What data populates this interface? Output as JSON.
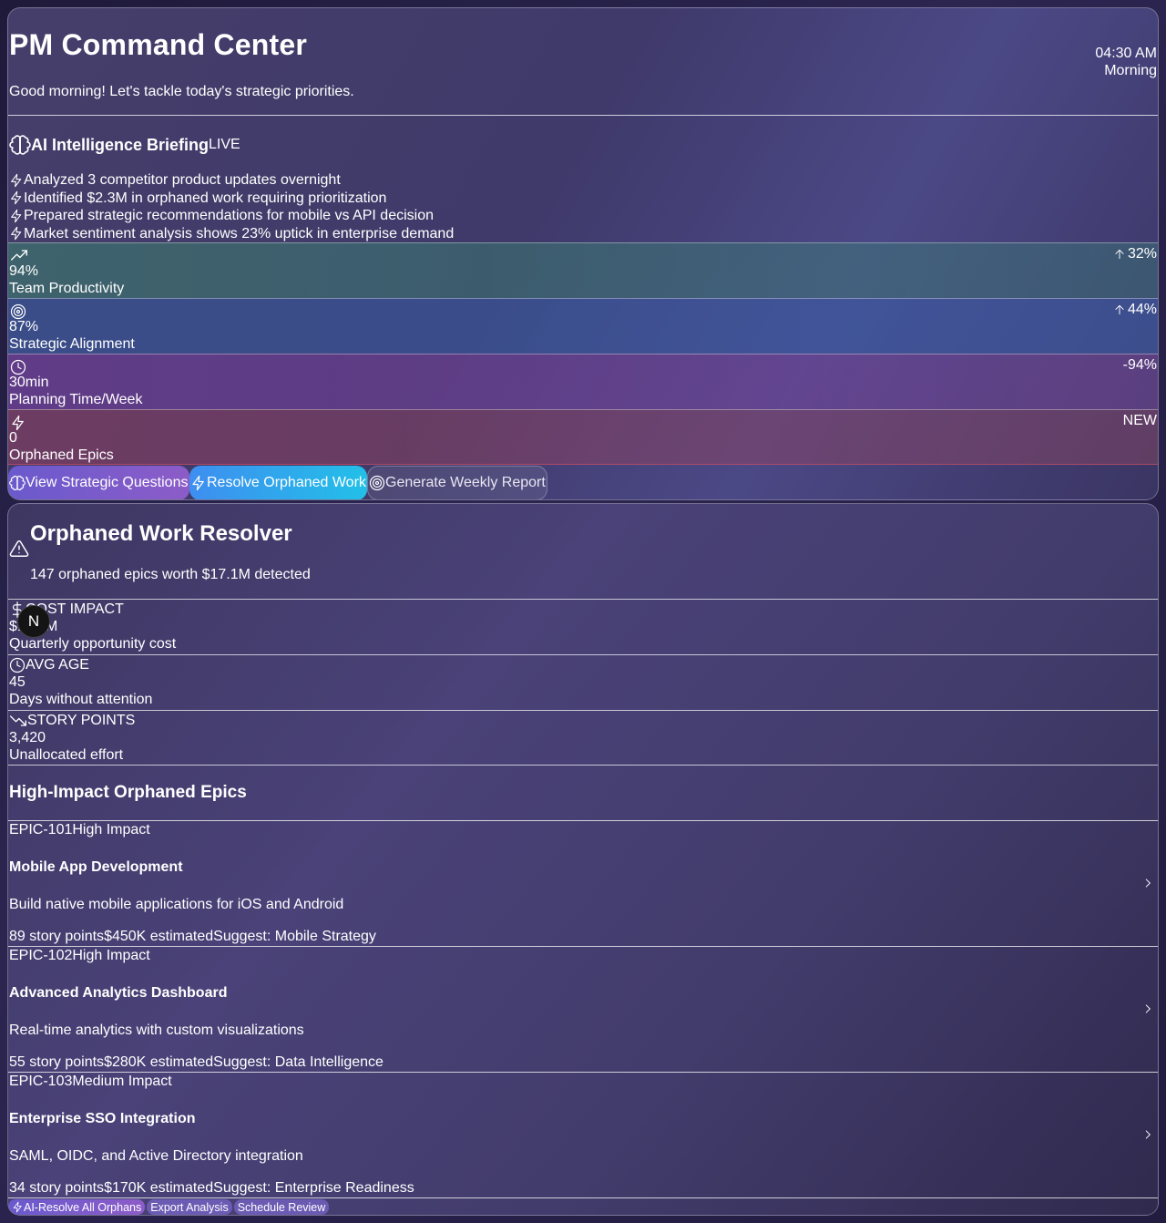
{
  "header": {
    "title": "PM Command Center",
    "greeting": "Good morning! Let's tackle today's strategic priorities.",
    "time": "04:30 AM",
    "period": "Morning"
  },
  "briefing": {
    "icon": "brain-icon",
    "title": "AI Intelligence Briefing",
    "status": "LIVE",
    "items": [
      "Analyzed 3 competitor product updates overnight",
      "Identified $2.3M in orphaned work requiring prioritization",
      "Prepared strategic recommendations for mobile vs API decision",
      "Market sentiment analysis shows 23% uptick in enterprise demand"
    ]
  },
  "metrics": [
    {
      "icon": "trending-up-icon",
      "value": "94%",
      "label": "Team Productivity",
      "trend": "32%",
      "trend_icon": "arrow-up-icon"
    },
    {
      "icon": "target-icon",
      "value": "87%",
      "label": "Strategic Alignment",
      "trend": "44%",
      "trend_icon": "arrow-up-icon"
    },
    {
      "icon": "clock-icon",
      "value": "30min",
      "label": "Planning Time/Week",
      "trend": "-94%"
    },
    {
      "icon": "zap-icon",
      "value": "0",
      "label": "Orphaned Epics",
      "trend": "NEW"
    }
  ],
  "actions": [
    {
      "icon": "brain-icon",
      "label": "View Strategic Questions"
    },
    {
      "icon": "zap-icon",
      "label": "Resolve Orphaned Work"
    },
    {
      "icon": "target-icon",
      "label": "Generate Weekly Report"
    }
  ],
  "orphaned": {
    "title": "Orphaned Work Resolver",
    "subtitle": "147 orphaned epics worth $17.1M detected",
    "stats": [
      {
        "icon": "dollar-icon",
        "label": "COST IMPACT",
        "value": "$17.1M",
        "sub": "Quarterly opportunity cost"
      },
      {
        "icon": "clock-icon",
        "label": "AVG AGE",
        "value": "45",
        "sub": "Days without attention"
      },
      {
        "icon": "trending-down-icon",
        "label": "STORY POINTS",
        "value": "3,420",
        "sub": "Unallocated effort"
      }
    ],
    "epics_title": "High-Impact Orphaned Epics",
    "epics": [
      {
        "id": "EPIC-101",
        "impact": "High Impact",
        "name": "Mobile App Development",
        "desc": "Build native mobile applications for iOS and Android",
        "points": "89 story points",
        "cost": "$450K estimated",
        "suggest": "Suggest: Mobile Strategy"
      },
      {
        "id": "EPIC-102",
        "impact": "High Impact",
        "name": "Advanced Analytics Dashboard",
        "desc": "Real-time analytics with custom visualizations",
        "points": "55 story points",
        "cost": "$280K estimated",
        "suggest": "Suggest: Data Intelligence"
      },
      {
        "id": "EPIC-103",
        "impact": "Medium Impact",
        "name": "Enterprise SSO Integration",
        "desc": "SAML, OIDC, and Active Directory integration",
        "points": "34 story points",
        "cost": "$170K estimated",
        "suggest": "Suggest: Enterprise Readiness"
      }
    ],
    "footer_actions": [
      {
        "icon": "zap-icon",
        "label": "AI-Resolve All Orphans"
      },
      {
        "label": "Export Analysis"
      },
      {
        "label": "Schedule Review"
      }
    ]
  },
  "overlay": {
    "avatar_letter": "N"
  }
}
